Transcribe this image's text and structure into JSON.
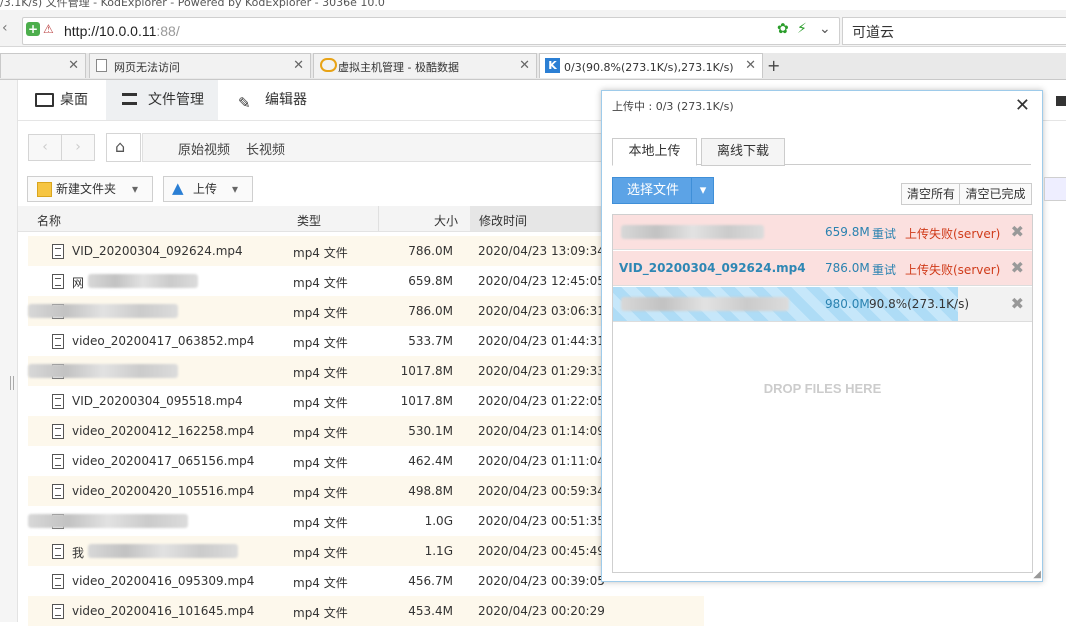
{
  "window": {
    "title": "/3.1K/s) 文件管理 - KodExplorer - Powered by KodExplorer - 3036e 10.0"
  },
  "browser": {
    "url_main": "http://10.0.0.11",
    "url_port": ":88/",
    "search_engine": "可道云",
    "tabs": [
      {
        "label": "",
        "active": false
      },
      {
        "label": "网页无法访问",
        "active": false
      },
      {
        "label": "虚拟主机管理 - 极酷数据",
        "active": false
      },
      {
        "label": "0/3(90.8%(273.1K/s),273.1K/s) 文件",
        "active": true
      }
    ],
    "new_tab": "+"
  },
  "app": {
    "nav": [
      {
        "label": "桌面",
        "icon": "monitor-icon",
        "selected": false
      },
      {
        "label": "文件管理",
        "icon": "folder-list-icon",
        "selected": true
      },
      {
        "label": "编辑器",
        "icon": "edit-icon",
        "selected": false
      }
    ],
    "breadcrumb": [
      "原始视频",
      "长视频"
    ],
    "actions": {
      "new_folder": "新建文件夹",
      "upload": "上传"
    },
    "columns": {
      "name": "名称",
      "type": "类型",
      "size": "大小",
      "modified": "修改时间"
    },
    "files": [
      {
        "name": "VID_20200304_092624.mp4",
        "type": "mp4 文件",
        "size": "786.0M",
        "modified": "2020/04/23 13:09:34"
      },
      {
        "name": "网",
        "type": "mp4 文件",
        "size": "659.8M",
        "modified": "2020/04/23 12:45:05"
      },
      {
        "name": "",
        "type": "mp4 文件",
        "size": "786.0M",
        "modified": "2020/04/23 03:06:31"
      },
      {
        "name": "video_20200417_063852.mp4",
        "type": "mp4 文件",
        "size": "533.7M",
        "modified": "2020/04/23 01:44:31"
      },
      {
        "name": "",
        "type": "mp4 文件",
        "size": "1017.8M",
        "modified": "2020/04/23 01:29:33"
      },
      {
        "name": "VID_20200304_095518.mp4",
        "type": "mp4 文件",
        "size": "1017.8M",
        "modified": "2020/04/23 01:22:05"
      },
      {
        "name": "video_20200412_162258.mp4",
        "type": "mp4 文件",
        "size": "530.1M",
        "modified": "2020/04/23 01:14:09"
      },
      {
        "name": "video_20200417_065156.mp4",
        "type": "mp4 文件",
        "size": "462.4M",
        "modified": "2020/04/23 01:11:04"
      },
      {
        "name": "video_20200420_105516.mp4",
        "type": "mp4 文件",
        "size": "498.8M",
        "modified": "2020/04/23 00:59:34"
      },
      {
        "name": "",
        "type": "mp4 文件",
        "size": "1.0G",
        "modified": "2020/04/23 00:51:35"
      },
      {
        "name": "我",
        "type": "mp4 文件",
        "size": "1.1G",
        "modified": "2020/04/23 00:45:49"
      },
      {
        "name": "video_20200416_095309.mp4",
        "type": "mp4 文件",
        "size": "456.7M",
        "modified": "2020/04/23 00:39:05"
      },
      {
        "name": "video_20200416_101645.mp4",
        "type": "mp4 文件",
        "size": "453.4M",
        "modified": "2020/04/23 00:20:29"
      }
    ]
  },
  "upload_dialog": {
    "title": "上传中 : 0/3 (273.1K/s)",
    "close": "✕",
    "tabs": [
      "本地上传",
      "离线下载"
    ],
    "choose_files": "选择文件",
    "clear_all": "清空所有",
    "clear_done": "清空已完成",
    "queue": [
      {
        "name": "",
        "size": "659.8M",
        "retry": "重试",
        "status": "上传失败(server)",
        "state": "error"
      },
      {
        "name": "VID_20200304_092624.mp4",
        "size": "786.0M",
        "retry": "重试",
        "status": "上传失败(server)",
        "state": "error"
      },
      {
        "name": "",
        "size": "980.0M",
        "progress": "90.8%(273.1K/s)",
        "progress_fraction": 0.908,
        "state": "uploading"
      }
    ],
    "drop_hint": "DROP FILES HERE"
  }
}
